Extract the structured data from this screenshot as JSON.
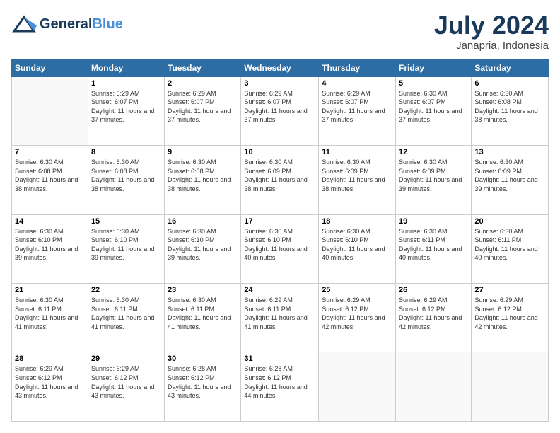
{
  "header": {
    "logo_general": "General",
    "logo_blue": "Blue",
    "month": "July 2024",
    "location": "Janapria, Indonesia"
  },
  "days_of_week": [
    "Sunday",
    "Monday",
    "Tuesday",
    "Wednesday",
    "Thursday",
    "Friday",
    "Saturday"
  ],
  "weeks": [
    [
      {
        "day": "",
        "sunrise": "",
        "sunset": "",
        "daylight": ""
      },
      {
        "day": "1",
        "sunrise": "Sunrise: 6:29 AM",
        "sunset": "Sunset: 6:07 PM",
        "daylight": "Daylight: 11 hours and 37 minutes."
      },
      {
        "day": "2",
        "sunrise": "Sunrise: 6:29 AM",
        "sunset": "Sunset: 6:07 PM",
        "daylight": "Daylight: 11 hours and 37 minutes."
      },
      {
        "day": "3",
        "sunrise": "Sunrise: 6:29 AM",
        "sunset": "Sunset: 6:07 PM",
        "daylight": "Daylight: 11 hours and 37 minutes."
      },
      {
        "day": "4",
        "sunrise": "Sunrise: 6:29 AM",
        "sunset": "Sunset: 6:07 PM",
        "daylight": "Daylight: 11 hours and 37 minutes."
      },
      {
        "day": "5",
        "sunrise": "Sunrise: 6:30 AM",
        "sunset": "Sunset: 6:07 PM",
        "daylight": "Daylight: 11 hours and 37 minutes."
      },
      {
        "day": "6",
        "sunrise": "Sunrise: 6:30 AM",
        "sunset": "Sunset: 6:08 PM",
        "daylight": "Daylight: 11 hours and 38 minutes."
      }
    ],
    [
      {
        "day": "7",
        "sunrise": "Sunrise: 6:30 AM",
        "sunset": "Sunset: 6:08 PM",
        "daylight": "Daylight: 11 hours and 38 minutes."
      },
      {
        "day": "8",
        "sunrise": "Sunrise: 6:30 AM",
        "sunset": "Sunset: 6:08 PM",
        "daylight": "Daylight: 11 hours and 38 minutes."
      },
      {
        "day": "9",
        "sunrise": "Sunrise: 6:30 AM",
        "sunset": "Sunset: 6:08 PM",
        "daylight": "Daylight: 11 hours and 38 minutes."
      },
      {
        "day": "10",
        "sunrise": "Sunrise: 6:30 AM",
        "sunset": "Sunset: 6:09 PM",
        "daylight": "Daylight: 11 hours and 38 minutes."
      },
      {
        "day": "11",
        "sunrise": "Sunrise: 6:30 AM",
        "sunset": "Sunset: 6:09 PM",
        "daylight": "Daylight: 11 hours and 38 minutes."
      },
      {
        "day": "12",
        "sunrise": "Sunrise: 6:30 AM",
        "sunset": "Sunset: 6:09 PM",
        "daylight": "Daylight: 11 hours and 39 minutes."
      },
      {
        "day": "13",
        "sunrise": "Sunrise: 6:30 AM",
        "sunset": "Sunset: 6:09 PM",
        "daylight": "Daylight: 11 hours and 39 minutes."
      }
    ],
    [
      {
        "day": "14",
        "sunrise": "Sunrise: 6:30 AM",
        "sunset": "Sunset: 6:10 PM",
        "daylight": "Daylight: 11 hours and 39 minutes."
      },
      {
        "day": "15",
        "sunrise": "Sunrise: 6:30 AM",
        "sunset": "Sunset: 6:10 PM",
        "daylight": "Daylight: 11 hours and 39 minutes."
      },
      {
        "day": "16",
        "sunrise": "Sunrise: 6:30 AM",
        "sunset": "Sunset: 6:10 PM",
        "daylight": "Daylight: 11 hours and 39 minutes."
      },
      {
        "day": "17",
        "sunrise": "Sunrise: 6:30 AM",
        "sunset": "Sunset: 6:10 PM",
        "daylight": "Daylight: 11 hours and 40 minutes."
      },
      {
        "day": "18",
        "sunrise": "Sunrise: 6:30 AM",
        "sunset": "Sunset: 6:10 PM",
        "daylight": "Daylight: 11 hours and 40 minutes."
      },
      {
        "day": "19",
        "sunrise": "Sunrise: 6:30 AM",
        "sunset": "Sunset: 6:11 PM",
        "daylight": "Daylight: 11 hours and 40 minutes."
      },
      {
        "day": "20",
        "sunrise": "Sunrise: 6:30 AM",
        "sunset": "Sunset: 6:11 PM",
        "daylight": "Daylight: 11 hours and 40 minutes."
      }
    ],
    [
      {
        "day": "21",
        "sunrise": "Sunrise: 6:30 AM",
        "sunset": "Sunset: 6:11 PM",
        "daylight": "Daylight: 11 hours and 41 minutes."
      },
      {
        "day": "22",
        "sunrise": "Sunrise: 6:30 AM",
        "sunset": "Sunset: 6:11 PM",
        "daylight": "Daylight: 11 hours and 41 minutes."
      },
      {
        "day": "23",
        "sunrise": "Sunrise: 6:30 AM",
        "sunset": "Sunset: 6:11 PM",
        "daylight": "Daylight: 11 hours and 41 minutes."
      },
      {
        "day": "24",
        "sunrise": "Sunrise: 6:29 AM",
        "sunset": "Sunset: 6:11 PM",
        "daylight": "Daylight: 11 hours and 41 minutes."
      },
      {
        "day": "25",
        "sunrise": "Sunrise: 6:29 AM",
        "sunset": "Sunset: 6:12 PM",
        "daylight": "Daylight: 11 hours and 42 minutes."
      },
      {
        "day": "26",
        "sunrise": "Sunrise: 6:29 AM",
        "sunset": "Sunset: 6:12 PM",
        "daylight": "Daylight: 11 hours and 42 minutes."
      },
      {
        "day": "27",
        "sunrise": "Sunrise: 6:29 AM",
        "sunset": "Sunset: 6:12 PM",
        "daylight": "Daylight: 11 hours and 42 minutes."
      }
    ],
    [
      {
        "day": "28",
        "sunrise": "Sunrise: 6:29 AM",
        "sunset": "Sunset: 6:12 PM",
        "daylight": "Daylight: 11 hours and 43 minutes."
      },
      {
        "day": "29",
        "sunrise": "Sunrise: 6:29 AM",
        "sunset": "Sunset: 6:12 PM",
        "daylight": "Daylight: 11 hours and 43 minutes."
      },
      {
        "day": "30",
        "sunrise": "Sunrise: 6:28 AM",
        "sunset": "Sunset: 6:12 PM",
        "daylight": "Daylight: 11 hours and 43 minutes."
      },
      {
        "day": "31",
        "sunrise": "Sunrise: 6:28 AM",
        "sunset": "Sunset: 6:12 PM",
        "daylight": "Daylight: 11 hours and 44 minutes."
      },
      {
        "day": "",
        "sunrise": "",
        "sunset": "",
        "daylight": ""
      },
      {
        "day": "",
        "sunrise": "",
        "sunset": "",
        "daylight": ""
      },
      {
        "day": "",
        "sunrise": "",
        "sunset": "",
        "daylight": ""
      }
    ]
  ]
}
